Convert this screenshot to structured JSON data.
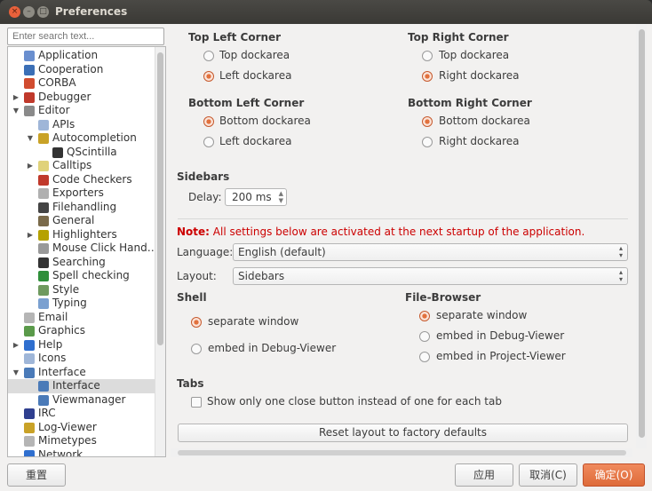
{
  "window": {
    "title": "Preferences",
    "close_glyph": "×",
    "min_glyph": "–",
    "max_glyph": "□"
  },
  "search": {
    "placeholder": "Enter search text..."
  },
  "tree": {
    "items": [
      {
        "label": "Application",
        "depth": 0,
        "arrow": "",
        "icon": "application-icon",
        "color": "#6a8fcf"
      },
      {
        "label": "Cooperation",
        "depth": 0,
        "arrow": "",
        "icon": "cooperation-icon",
        "color": "#3b6fb6"
      },
      {
        "label": "CORBA",
        "depth": 0,
        "arrow": "",
        "icon": "corba-icon",
        "color": "#d14c2f"
      },
      {
        "label": "Debugger",
        "depth": 0,
        "arrow": "▶",
        "icon": "bug-icon",
        "color": "#c0392b"
      },
      {
        "label": "Editor",
        "depth": 0,
        "arrow": "▼",
        "icon": "editor-icon",
        "color": "#8a8a8a"
      },
      {
        "label": "APIs",
        "depth": 1,
        "arrow": "",
        "icon": "apis-icon",
        "color": "#9fb6d8"
      },
      {
        "label": "Autocompletion",
        "depth": 1,
        "arrow": "▼",
        "icon": "wand-icon",
        "color": "#c9a227"
      },
      {
        "label": "QScintilla",
        "depth": 2,
        "arrow": "",
        "icon": "qscintilla-icon",
        "color": "#333333"
      },
      {
        "label": "Calltips",
        "depth": 1,
        "arrow": "▶",
        "icon": "calltips-icon",
        "color": "#e0d27a"
      },
      {
        "label": "Code Checkers",
        "depth": 1,
        "arrow": "",
        "icon": "bug-icon",
        "color": "#c0392b"
      },
      {
        "label": "Exporters",
        "depth": 1,
        "arrow": "",
        "icon": "exporters-icon",
        "color": "#b0b0b0"
      },
      {
        "label": "Filehandling",
        "depth": 1,
        "arrow": "",
        "icon": "floppy-icon",
        "color": "#444444"
      },
      {
        "label": "General",
        "depth": 1,
        "arrow": "",
        "icon": "general-icon",
        "color": "#7a6a4a"
      },
      {
        "label": "Highlighters",
        "depth": 1,
        "arrow": "▶",
        "icon": "highlighters-icon",
        "color": "#b5a100"
      },
      {
        "label": "Mouse Click Hand…",
        "depth": 1,
        "arrow": "",
        "icon": "mouse-icon",
        "color": "#999999"
      },
      {
        "label": "Searching",
        "depth": 1,
        "arrow": "",
        "icon": "binoculars-icon",
        "color": "#333333"
      },
      {
        "label": "Spell checking",
        "depth": 1,
        "arrow": "",
        "icon": "spellcheck-icon",
        "color": "#2f8f3a"
      },
      {
        "label": "Style",
        "depth": 1,
        "arrow": "",
        "icon": "style-icon",
        "color": "#6f9a5f"
      },
      {
        "label": "Typing",
        "depth": 1,
        "arrow": "",
        "icon": "typing-icon",
        "color": "#7aa0d0"
      },
      {
        "label": "Email",
        "depth": 0,
        "arrow": "",
        "icon": "email-icon",
        "color": "#b5b5b5"
      },
      {
        "label": "Graphics",
        "depth": 0,
        "arrow": "",
        "icon": "graphics-icon",
        "color": "#5a9a4a"
      },
      {
        "label": "Help",
        "depth": 0,
        "arrow": "▶",
        "icon": "help-icon",
        "color": "#2f6fcf"
      },
      {
        "label": "Icons",
        "depth": 0,
        "arrow": "",
        "icon": "icons-icon",
        "color": "#9fb6d8"
      },
      {
        "label": "Interface",
        "depth": 0,
        "arrow": "▼",
        "icon": "monitor-icon",
        "color": "#4a7ab8"
      },
      {
        "label": "Interface",
        "depth": 1,
        "arrow": "",
        "icon": "monitor-icon",
        "color": "#4a7ab8",
        "selected": true
      },
      {
        "label": "Viewmanager",
        "depth": 1,
        "arrow": "",
        "icon": "viewmanager-icon",
        "color": "#4a7ab8"
      },
      {
        "label": "IRC",
        "depth": 0,
        "arrow": "",
        "icon": "irc-icon",
        "color": "#2f3f8f"
      },
      {
        "label": "Log-Viewer",
        "depth": 0,
        "arrow": "",
        "icon": "log-icon",
        "color": "#c9a227"
      },
      {
        "label": "Mimetypes",
        "depth": 0,
        "arrow": "",
        "icon": "mimetypes-icon",
        "color": "#b5b5b5"
      },
      {
        "label": "Network",
        "depth": 0,
        "arrow": "",
        "icon": "network-icon",
        "color": "#2f6fcf"
      }
    ]
  },
  "corners": {
    "top_left": {
      "title": "Top Left Corner",
      "opt1": "Top dockarea",
      "opt2": "Left dockarea"
    },
    "top_right": {
      "title": "Top Right Corner",
      "opt1": "Top dockarea",
      "opt2": "Right dockarea"
    },
    "bottom_left": {
      "title": "Bottom Left Corner",
      "opt1": "Bottom dockarea",
      "opt2": "Left dockarea"
    },
    "bottom_right": {
      "title": "Bottom Right Corner",
      "opt1": "Bottom dockarea",
      "opt2": "Right dockarea"
    }
  },
  "sidebars": {
    "title": "Sidebars",
    "delay_label": "Delay:",
    "delay_value": "200 ms"
  },
  "note": {
    "prefix": "Note:",
    "text": " All settings below are activated at the next startup of the application."
  },
  "language": {
    "label": "Language:",
    "value": "English (default)"
  },
  "layout": {
    "label": "Layout:",
    "value": "Sidebars"
  },
  "shell": {
    "title": "Shell",
    "opt1": "separate window",
    "opt2": "embed in Debug-Viewer"
  },
  "file_browser": {
    "title": "File-Browser",
    "opt1": "separate window",
    "opt2": "embed in Debug-Viewer",
    "opt3": "embed in Project-Viewer"
  },
  "tabs": {
    "title": "Tabs",
    "checkbox_label": "Show only one close button instead of one for each tab"
  },
  "reset_label": "Reset layout to factory defaults",
  "buttons": {
    "reset": "重置",
    "apply": "应用",
    "cancel": "取消(C)",
    "ok": "确定(O)"
  },
  "colors": {
    "accent": "#e2713d",
    "note_red": "#cc0000"
  }
}
